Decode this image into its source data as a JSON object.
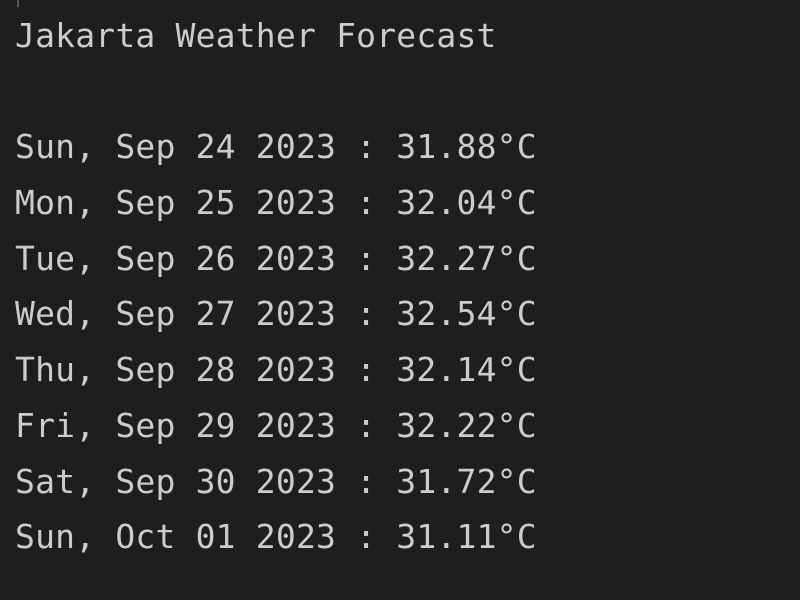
{
  "title": "Jakarta Weather Forecast",
  "separator": " : ",
  "forecast": [
    {
      "date": "Sun, Sep 24 2023",
      "temp": "31.88°C"
    },
    {
      "date": "Mon, Sep 25 2023",
      "temp": "32.04°C"
    },
    {
      "date": "Tue, Sep 26 2023",
      "temp": "32.27°C"
    },
    {
      "date": "Wed, Sep 27 2023",
      "temp": "32.54°C"
    },
    {
      "date": "Thu, Sep 28 2023",
      "temp": "32.14°C"
    },
    {
      "date": "Fri, Sep 29 2023",
      "temp": "32.22°C"
    },
    {
      "date": "Sat, Sep 30 2023",
      "temp": "31.72°C"
    },
    {
      "date": "Sun, Oct 01 2023",
      "temp": "31.11°C"
    }
  ],
  "colors": {
    "background": "#1e1e1e",
    "text": "#cccccc"
  }
}
